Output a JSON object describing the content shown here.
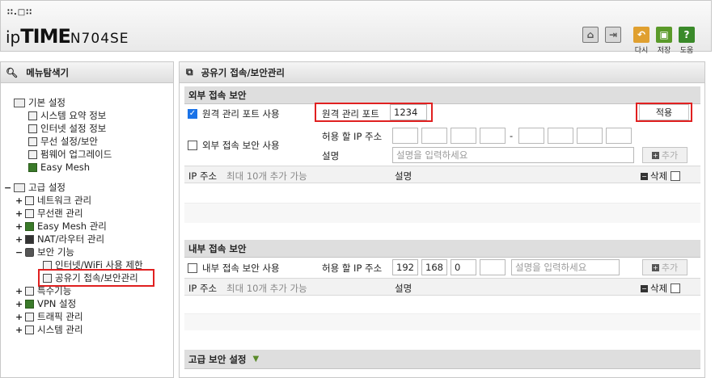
{
  "header": {
    "logo_dots": "∷.□∷",
    "logo_ip": "ip",
    "logo_time": "TIME",
    "model": "N704SE",
    "buttons": [
      {
        "name": "home",
        "label": ""
      },
      {
        "name": "logout",
        "label": ""
      },
      {
        "name": "redo",
        "label": "다시"
      },
      {
        "name": "save",
        "label": "저장"
      },
      {
        "name": "help",
        "label": "도움"
      }
    ]
  },
  "sidebar": {
    "title": "메뉴탐색기",
    "basic": {
      "label": "기본 설정",
      "items": [
        "시스템 요약 정보",
        "인터넷 설정 정보",
        "무선 설정/보안",
        "펌웨어 업그레이드",
        "Easy Mesh"
      ]
    },
    "advanced": {
      "label": "고급 설정",
      "items": [
        "네트워크 관리",
        "무선랜 관리",
        "Easy Mesh 관리",
        "NAT/라우터 관리",
        "보안 기능"
      ],
      "security_children": [
        "인터넷/WiFi 사용 제한",
        "공유기 접속/보안관리"
      ],
      "more_items": [
        "특수기능",
        "VPN 설정",
        "트래픽 관리",
        "시스템 관리"
      ]
    }
  },
  "main": {
    "title": "공유기 접속/보안관리",
    "external": {
      "title": "외부 접속 보안",
      "remote_port_checkbox": "원격 관리 포트 사용",
      "remote_port_checked": true,
      "remote_port_label": "원격 관리 포트",
      "remote_port_value": "1234",
      "apply_label": "적용",
      "ext_access_checkbox": "외부 접속 보안 사용",
      "allowed_ip_label": "허용 할 IP 주소",
      "ip_dash": "-",
      "desc_label": "설명",
      "desc_placeholder": "설명을 입력하세요",
      "add_label": "추가",
      "list_ip_header": "IP 주소",
      "list_ip_note": "최대 10개 추가 가능",
      "list_desc_header": "설명",
      "list_delete_label": "삭제"
    },
    "internal": {
      "title": "내부 접속 보안",
      "checkbox_label": "내부 접속 보안 사용",
      "allowed_ip_label": "허용 할 IP 주소",
      "ip": [
        "192",
        "168",
        "0",
        ""
      ],
      "desc_placeholder": "설명을 입력하세요",
      "add_label": "추가",
      "list_ip_header": "IP 주소",
      "list_ip_note": "최대 10개 추가 가능",
      "list_desc_header": "설명",
      "list_delete_label": "삭제"
    },
    "advanced": {
      "title": "고급 보안 설정"
    }
  },
  "colors": {
    "highlight_red": "#e02020",
    "header_gray": "#dedede",
    "checkbox_blue": "#1a73e8",
    "redo_orange": "#e0a030",
    "save_green": "#5a9a2a",
    "help_green": "#3a8a2a"
  }
}
